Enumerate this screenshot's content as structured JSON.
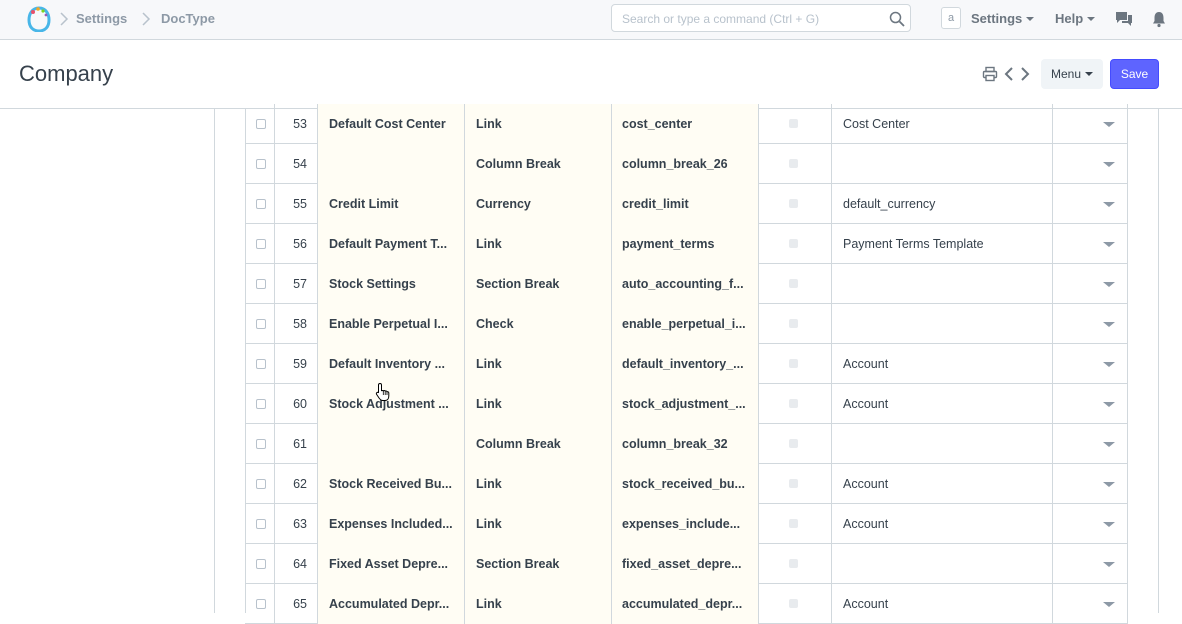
{
  "navbar": {
    "breadcrumbs": [
      "Settings",
      "DocType"
    ],
    "search_placeholder": "Search or type a command (Ctrl + G)",
    "avatar_letter": "a",
    "settings_label": "Settings",
    "help_label": "Help"
  },
  "page": {
    "title": "Company",
    "menu_label": "Menu",
    "save_label": "Save"
  },
  "colors": {
    "primary": "#5e64ff",
    "border": "#d1d8dd",
    "highlight_cell": "#fffdf4"
  },
  "icons": [
    "logo-icon",
    "chevron-right-icon",
    "search-icon",
    "chat-icon",
    "bell-icon",
    "print-icon",
    "chevron-left-icon",
    "chevron-right-icon",
    "pointer-cursor-icon"
  ],
  "fields": [
    {
      "idx": "53",
      "label": "Default Cost Center",
      "type": "Link",
      "name": "cost_center",
      "options": "Cost Center"
    },
    {
      "idx": "54",
      "label": "",
      "type": "Column Break",
      "name": "column_break_26",
      "options": ""
    },
    {
      "idx": "55",
      "label": "Credit Limit",
      "type": "Currency",
      "name": "credit_limit",
      "options": "default_currency"
    },
    {
      "idx": "56",
      "label": "Default Payment T...",
      "type": "Link",
      "name": "payment_terms",
      "options": "Payment Terms Template"
    },
    {
      "idx": "57",
      "label": "Stock Settings",
      "type": "Section Break",
      "name": "auto_accounting_f...",
      "options": ""
    },
    {
      "idx": "58",
      "label": "Enable Perpetual I...",
      "type": "Check",
      "name": "enable_perpetual_i...",
      "options": ""
    },
    {
      "idx": "59",
      "label": "Default Inventory ...",
      "type": "Link",
      "name": "default_inventory_...",
      "options": "Account"
    },
    {
      "idx": "60",
      "label": "Stock Adjustment ...",
      "type": "Link",
      "name": "stock_adjustment_...",
      "options": "Account"
    },
    {
      "idx": "61",
      "label": "",
      "type": "Column Break",
      "name": "column_break_32",
      "options": ""
    },
    {
      "idx": "62",
      "label": "Stock Received Bu...",
      "type": "Link",
      "name": "stock_received_bu...",
      "options": "Account"
    },
    {
      "idx": "63",
      "label": "Expenses Included...",
      "type": "Link",
      "name": "expenses_include...",
      "options": "Account"
    },
    {
      "idx": "64",
      "label": "Fixed Asset Depre...",
      "type": "Section Break",
      "name": "fixed_asset_depre...",
      "options": ""
    },
    {
      "idx": "65",
      "label": "Accumulated Depr...",
      "type": "Link",
      "name": "accumulated_depr...",
      "options": "Account"
    }
  ]
}
